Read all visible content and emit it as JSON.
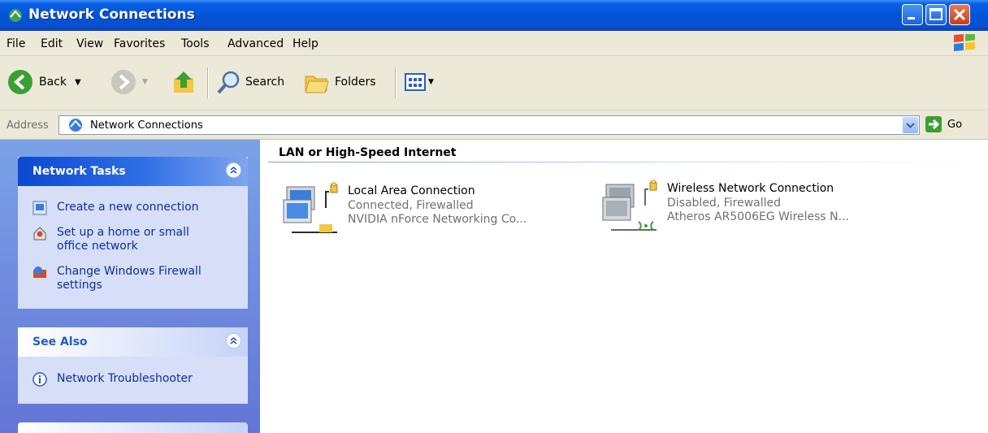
{
  "window": {
    "title": "Network Connections"
  },
  "menu": [
    "File",
    "Edit",
    "View",
    "Favorites",
    "Tools",
    "Advanced",
    "Help"
  ],
  "toolbar": {
    "back_label": "Back",
    "search_label": "Search",
    "folders_label": "Folders"
  },
  "address": {
    "label": "Address",
    "value": "Network Connections",
    "go_label": "Go"
  },
  "network_tasks": {
    "title": "Network Tasks",
    "items": [
      {
        "label": "Create a new connection",
        "icon": "new-connection-icon"
      },
      {
        "label": "Set up a home or small office network",
        "icon": "home-network-icon"
      },
      {
        "label": "Change Windows Firewall settings",
        "icon": "firewall-icon"
      }
    ]
  },
  "see_also": {
    "title": "See Also",
    "items": [
      {
        "label": "Network Troubleshooter",
        "icon": "info-icon"
      }
    ]
  },
  "content": {
    "group": "LAN or High-Speed Internet",
    "connections": [
      {
        "name": "Local Area Connection",
        "status": "Connected, Firewalled",
        "device": "NVIDIA nForce Networking Co..."
      },
      {
        "name": "Wireless Network Connection",
        "status": "Disabled, Firewalled",
        "device": "Atheros AR5006EG Wireless N..."
      }
    ]
  },
  "colors": {
    "title_bar": "#0254d6",
    "task_pane": "#6f8de0",
    "link": "#0c2f9e"
  }
}
